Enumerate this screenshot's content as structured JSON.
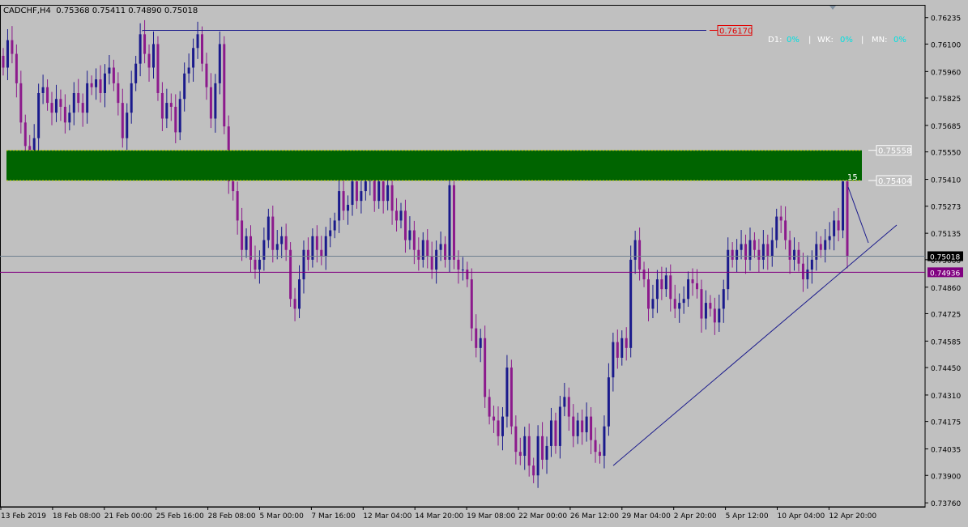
{
  "symbol_info": {
    "symbol": "CADCHF,H4",
    "open": "0.75368",
    "high": "0.75411",
    "low": "0.74890",
    "close": "0.75018"
  },
  "indicators": {
    "d1_label": "D1:",
    "d1_value": "0%",
    "wk_label": "WK:",
    "wk_value": "0%",
    "mn_label": "MN:",
    "mn_value": "0%",
    "separator": "|"
  },
  "price_labels": {
    "resistance_line": "0.76170",
    "zone_top": "0.75558",
    "zone_bottom": "0.75404",
    "current_bid": "0.75018",
    "horizontal_line": "0.74936"
  },
  "annotation_count": "15",
  "colors": {
    "background": "#c0c0c0",
    "bull_candle": "#1a1a8c",
    "bear_candle": "#8c1a8c",
    "zone_fill": "#006400",
    "zone_border": "#c8c800",
    "trendline": "#1a1a8c",
    "magenta_line": "#800080",
    "current_price_line": "#708090",
    "indicator_value": "#00e0e0",
    "resistance_label_bg": "#e00000"
  },
  "chart_data": {
    "type": "candlestick",
    "title": "CADCHF,H4",
    "ylim": [
      0.7374,
      0.763
    ],
    "y_ticks": [
      "0.76235",
      "0.76100",
      "0.75960",
      "0.75825",
      "0.75685",
      "0.75550",
      "0.75410",
      "0.75273",
      "0.75135",
      "0.75000",
      "0.74860",
      "0.74725",
      "0.74585",
      "0.74450",
      "0.74310",
      "0.74175",
      "0.74035",
      "0.73900",
      "0.73760"
    ],
    "x_ticks": [
      "13 Feb 2019",
      "18 Feb 08:00",
      "21 Feb 00:00",
      "25 Feb 16:00",
      "28 Feb 08:00",
      "5 Mar 00:00",
      "7 Mar 16:00",
      "12 Mar 04:00",
      "14 Mar 20:00",
      "19 Mar 08:00",
      "22 Mar 00:00",
      "26 Mar 12:00",
      "29 Mar 04:00",
      "2 Apr 20:00",
      "5 Apr 12:00",
      "10 Apr 04:00",
      "12 Apr 20:00"
    ],
    "closes": [
      0.7598,
      0.7612,
      0.7605,
      0.759,
      0.757,
      0.7558,
      0.7555,
      0.7562,
      0.7585,
      0.7588,
      0.758,
      0.7575,
      0.7582,
      0.7578,
      0.757,
      0.7575,
      0.7585,
      0.758,
      0.7575,
      0.759,
      0.7588,
      0.7592,
      0.7585,
      0.7595,
      0.7598,
      0.759,
      0.758,
      0.7562,
      0.7575,
      0.759,
      0.76,
      0.7615,
      0.7605,
      0.7598,
      0.761,
      0.7585,
      0.7572,
      0.758,
      0.7578,
      0.7565,
      0.7582,
      0.7595,
      0.7598,
      0.7608,
      0.7615,
      0.76,
      0.7588,
      0.7572,
      0.759,
      0.761,
      0.7568,
      0.754,
      0.7535,
      0.752,
      0.7505,
      0.7512,
      0.75,
      0.7495,
      0.75,
      0.751,
      0.7522,
      0.7505,
      0.7508,
      0.7512,
      0.7505,
      0.748,
      0.7475,
      0.749,
      0.7505,
      0.75,
      0.7512,
      0.7505,
      0.7502,
      0.7512,
      0.7515,
      0.752,
      0.7535,
      0.7525,
      0.7528,
      0.754,
      0.753,
      0.7535,
      0.754,
      0.7545,
      0.753,
      0.754,
      0.753,
      0.7538,
      0.7525,
      0.752,
      0.7525,
      0.751,
      0.7515,
      0.7505,
      0.75,
      0.751,
      0.7502,
      0.7495,
      0.7505,
      0.7508,
      0.75,
      0.7538,
      0.75,
      0.7495,
      0.7495,
      0.749,
      0.7465,
      0.7455,
      0.746,
      0.743,
      0.742,
      0.7418,
      0.741,
      0.742,
      0.7445,
      0.7415,
      0.7402,
      0.74,
      0.741,
      0.7395,
      0.739,
      0.741,
      0.7398,
      0.7405,
      0.7418,
      0.7405,
      0.7425,
      0.743,
      0.742,
      0.741,
      0.7418,
      0.7412,
      0.742,
      0.7408,
      0.7402,
      0.74,
      0.7415,
      0.744,
      0.7458,
      0.745,
      0.746,
      0.7455,
      0.75,
      0.751,
      0.7495,
      0.749,
      0.7475,
      0.748,
      0.749,
      0.7485,
      0.7492,
      0.748,
      0.7475,
      0.7478,
      0.748,
      0.749,
      0.7488,
      0.7485,
      0.747,
      0.7478,
      0.7475,
      0.7468,
      0.7475,
      0.7485,
      0.7505,
      0.75,
      0.7505,
      0.7508,
      0.75,
      0.751,
      0.7505,
      0.75,
      0.7508,
      0.7502,
      0.751,
      0.7522,
      0.752,
      0.751,
      0.75,
      0.7505,
      0.7498,
      0.749,
      0.7495,
      0.75,
      0.7508,
      0.7505,
      0.751,
      0.7512,
      0.752,
      0.7515,
      0.754,
      0.7502
    ],
    "resistance_line_price": 0.7617,
    "zone_top": 0.75558,
    "zone_bottom": 0.75404,
    "current_price": 0.75018,
    "horizontal_line_price": 0.74936,
    "trendline": {
      "start_price": 0.7395,
      "end_price": 0.7512
    }
  }
}
